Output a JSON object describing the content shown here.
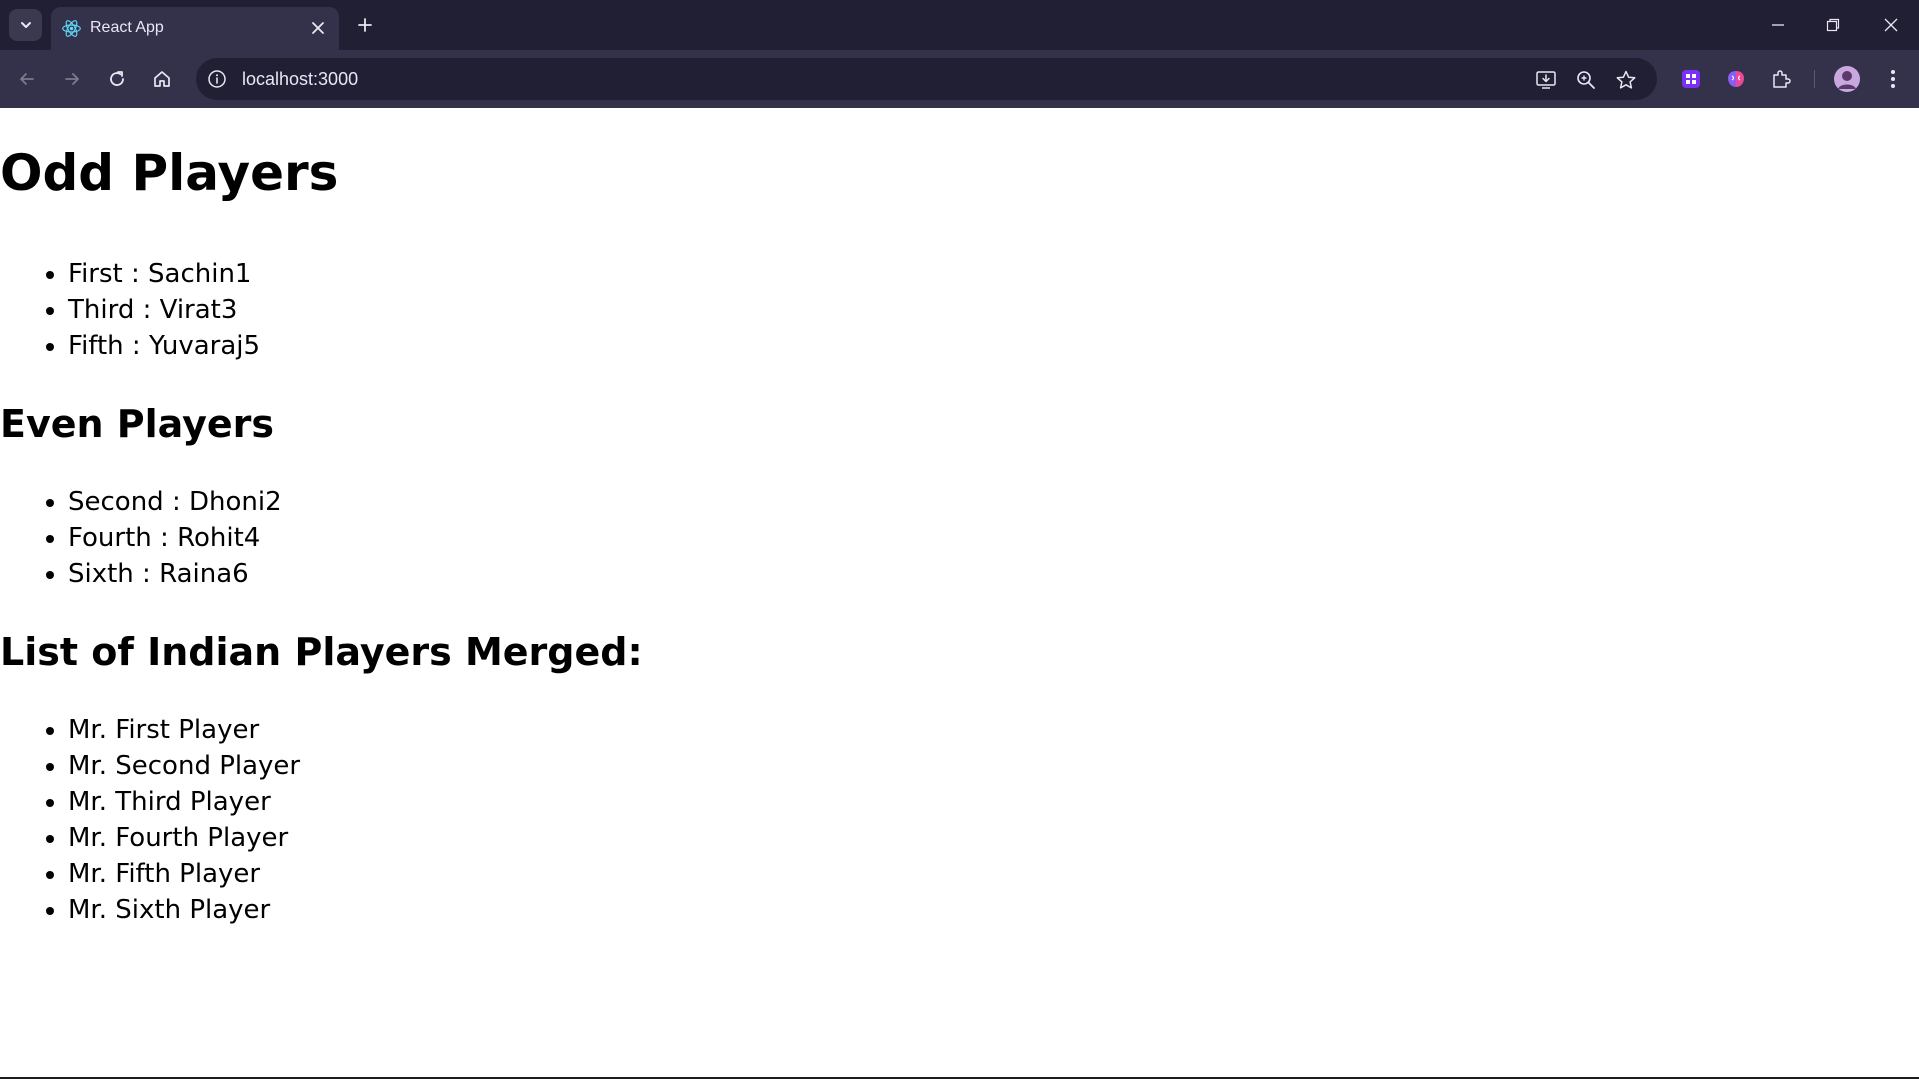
{
  "browser": {
    "tab_title": "React App",
    "url": "localhost:3000",
    "icons": {
      "tab_search": "chevron-down-icon",
      "favicon": "react-logo-icon",
      "tab_close": "close-icon",
      "new_tab": "plus-icon",
      "minimize": "minimize-icon",
      "restore": "restore-icon",
      "close_window": "close-icon",
      "back": "arrow-left-icon",
      "forward": "arrow-right-icon",
      "reload": "reload-icon",
      "home": "home-icon",
      "site_info": "info-icon",
      "install": "install-app-icon",
      "zoom": "zoom-icon",
      "bookmark": "star-icon",
      "ext1": "grid-extension-icon",
      "ext2": "brain-extension-icon",
      "extensions": "puzzle-icon",
      "profile": "avatar-icon",
      "menu": "kebab-menu-icon"
    },
    "colors": {
      "tabstrip": "#211f33",
      "toolbar": "#34324a",
      "accent": "#8b5cf6"
    }
  },
  "page": {
    "odd_heading": "Odd Players",
    "odd_players": [
      "First : Sachin1",
      "Third : Virat3",
      "Fifth : Yuvaraj5"
    ],
    "even_heading": "Even Players",
    "even_players": [
      "Second : Dhoni2",
      "Fourth : Rohit4",
      "Sixth : Raina6"
    ],
    "merged_heading": "List of Indian Players Merged:",
    "merged_players": [
      "Mr. First Player",
      "Mr. Second Player",
      "Mr. Third Player",
      "Mr. Fourth Player",
      "Mr. Fifth Player",
      "Mr. Sixth Player"
    ]
  }
}
